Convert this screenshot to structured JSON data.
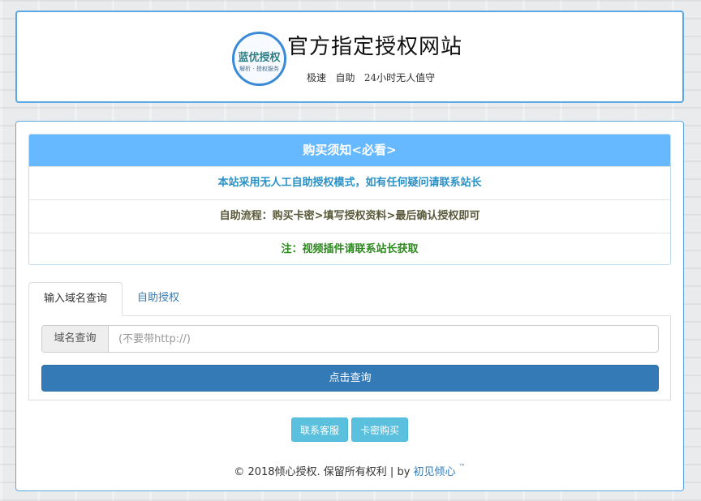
{
  "header": {
    "logo_text": "蓝优授权",
    "logo_sub": "解析 · 授权服务",
    "title": "官方指定授权网站",
    "subtitle": "极速   自助   24小时无人值守"
  },
  "notice": {
    "heading": "购买须知<必看>",
    "rows": [
      "本站采用无人工自助授权模式，如有任何疑问请联系站长",
      "自助流程：购买卡密>填写授权资料>最后确认授权即可",
      "注：视频插件请联系站长获取"
    ]
  },
  "tabs": [
    "输入域名查询",
    "自助授权"
  ],
  "query": {
    "addon_label": "域名查询",
    "placeholder": "(不要带http://)",
    "submit_label": "点击查询"
  },
  "actions": [
    "联系客服",
    "卡密购买"
  ],
  "footer": {
    "copyright": "© 2018倾心授权. 保留所有权利 | by ",
    "author_link": "初见倾心",
    "trademark": "™"
  },
  "colors": {
    "accent": "#5aa7e6",
    "notice_header": "#66b8ff",
    "primary_button": "#337ab7",
    "info_button": "#5bc0de"
  }
}
